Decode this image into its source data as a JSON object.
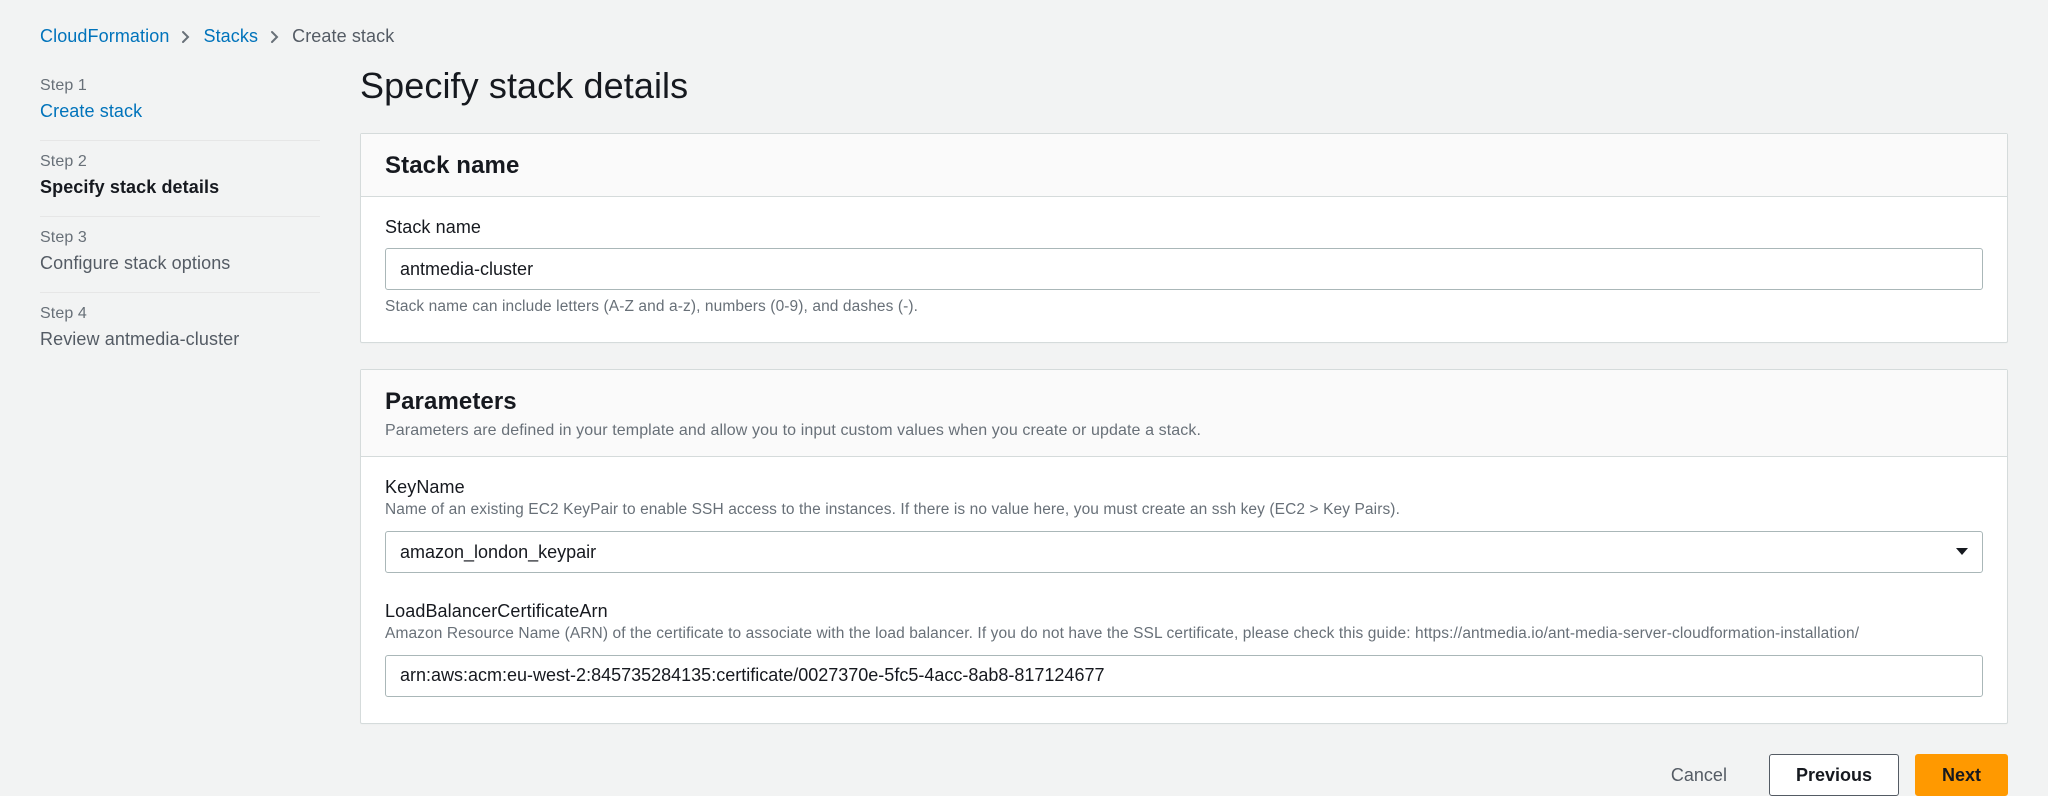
{
  "breadcrumb": {
    "items": [
      {
        "label": "CloudFormation",
        "link": true
      },
      {
        "label": "Stacks",
        "link": true
      },
      {
        "label": "Create stack",
        "link": false
      }
    ]
  },
  "wizard": {
    "steps": [
      {
        "num": "Step 1",
        "title": "Create stack",
        "state": "done"
      },
      {
        "num": "Step 2",
        "title": "Specify stack details",
        "state": "active"
      },
      {
        "num": "Step 3",
        "title": "Configure stack options",
        "state": "pending"
      },
      {
        "num": "Step 4",
        "title": "Review antmedia-cluster",
        "state": "pending"
      }
    ]
  },
  "page": {
    "title": "Specify stack details"
  },
  "stack_name_panel": {
    "heading": "Stack name",
    "field_label": "Stack name",
    "value": "antmedia-cluster",
    "hint": "Stack name can include letters (A-Z and a-z), numbers (0-9), and dashes (-)."
  },
  "parameters_panel": {
    "heading": "Parameters",
    "subheading": "Parameters are defined in your template and allow you to input custom values when you create or update a stack.",
    "fields": [
      {
        "label": "KeyName",
        "desc": "Name of an existing EC2 KeyPair to enable SSH access to the instances. If there is no value here, you must create an ssh key (EC2 > Key Pairs).",
        "value": "amazon_london_keypair",
        "type": "select"
      },
      {
        "label": "LoadBalancerCertificateArn",
        "desc": "Amazon Resource Name (ARN) of the certificate to associate with the load balancer. If you do not have the SSL certificate, please check this guide: https://antmedia.io/ant-media-server-cloudformation-installation/",
        "value": "arn:aws:acm:eu-west-2:845735284135:certificate/0027370e-5fc5-4acc-8ab8-817124677",
        "type": "text"
      }
    ]
  },
  "footer": {
    "cancel": "Cancel",
    "previous": "Previous",
    "next": "Next"
  }
}
